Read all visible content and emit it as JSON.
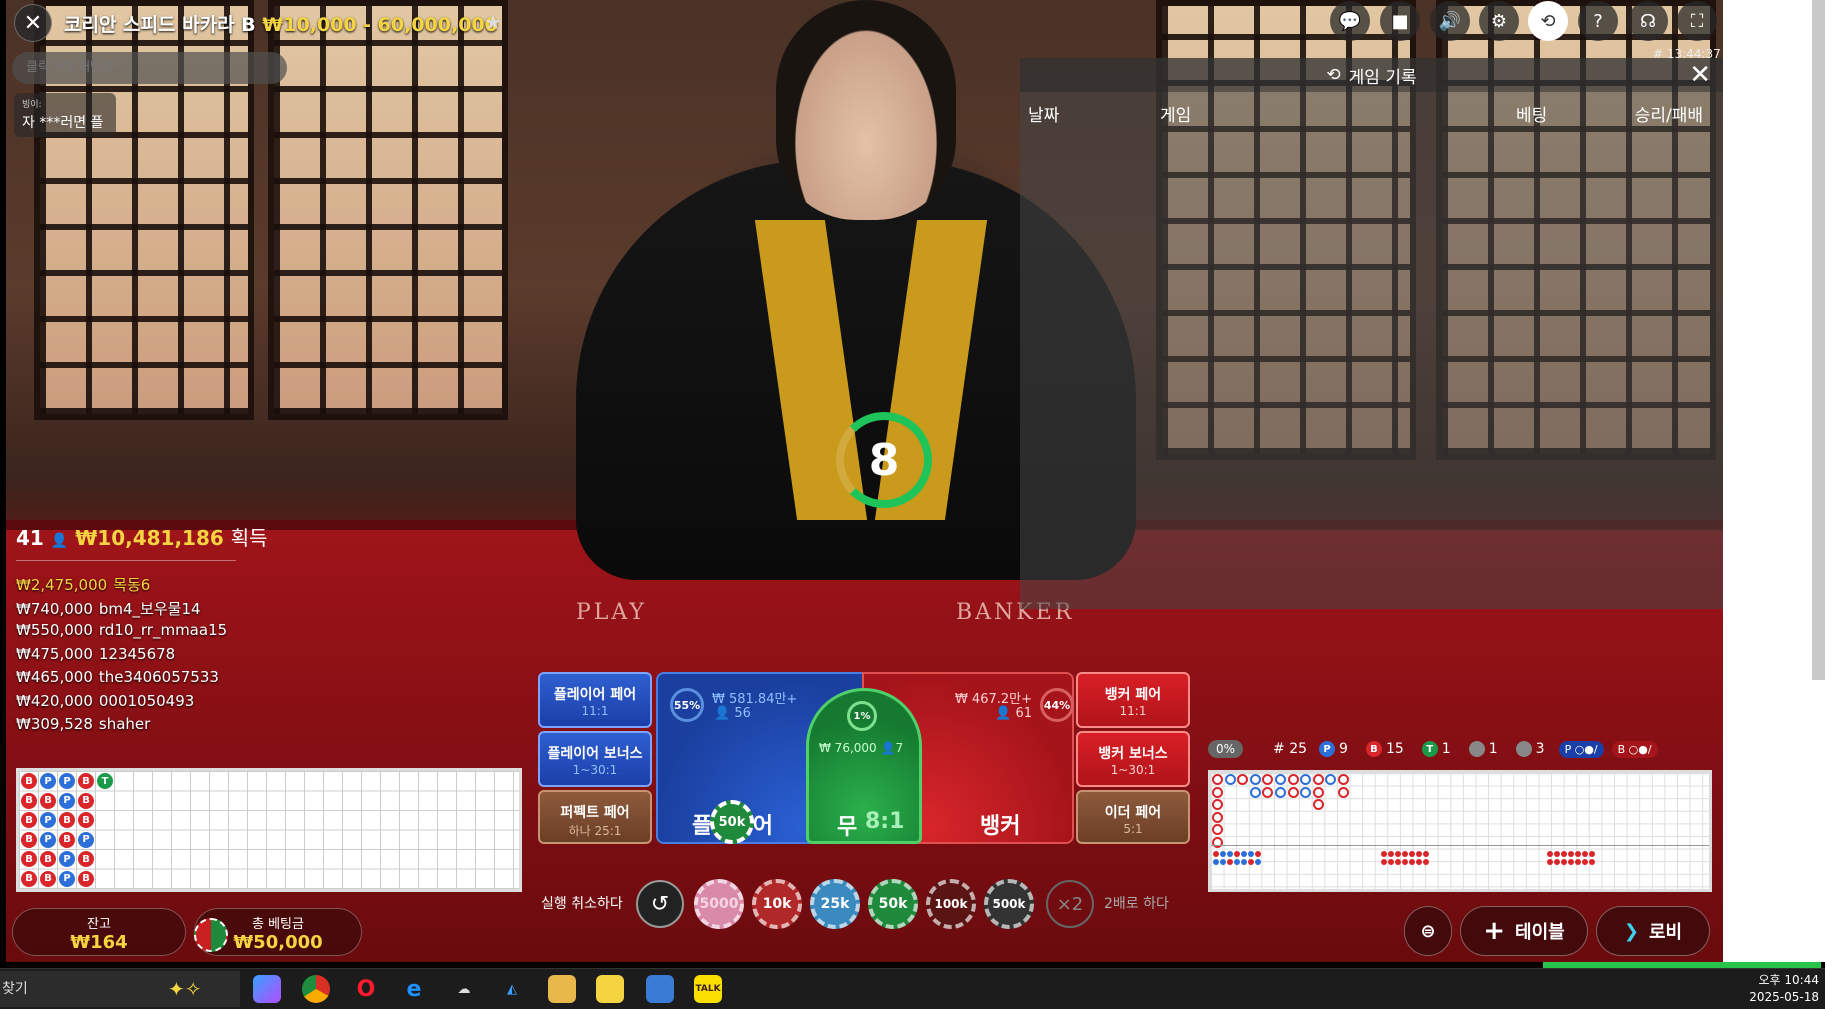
{
  "title": {
    "name": "코리안 스피드 바카라 B",
    "limits": "₩10,000 - 60,000,000"
  },
  "top_icons": [
    "chat-icon",
    "video-icon",
    "volume-icon",
    "gear-icon",
    "history-icon",
    "help-icon",
    "lobby-support-icon",
    "fullscreen-icon"
  ],
  "clock": "# 13:44:37",
  "chat": {
    "placeholder": "클릭하여 채팅하기",
    "sender": "빙이:",
    "message": "자 ***러면 플"
  },
  "history": {
    "title": "게임 기록",
    "columns": [
      "날짜",
      "게임",
      "베팅",
      "승리/패배"
    ]
  },
  "timer": "8",
  "winners": {
    "count": "41",
    "total": "₩10,481,186",
    "label": "획득",
    "list": [
      {
        "amount": "₩2,475,000",
        "name": "목동6"
      },
      {
        "amount": "₩740,000",
        "name": "bm4_보우물14"
      },
      {
        "amount": "₩550,000",
        "name": "rd10_rr_mmaa15"
      },
      {
        "amount": "₩475,000",
        "name": "12345678"
      },
      {
        "amount": "₩465,000",
        "name": "the3406057533"
      },
      {
        "amount": "₩420,000",
        "name": "0001050493"
      },
      {
        "amount": "₩309,528",
        "name": "shaher"
      }
    ]
  },
  "bead_road": [
    [
      "B",
      "B",
      "B",
      "B",
      "B",
      "B"
    ],
    [
      "P",
      "B",
      "P",
      "P",
      "B",
      "B"
    ],
    [
      "P",
      "P",
      "B",
      "B",
      "P",
      "P"
    ],
    [
      "B",
      "B",
      "B",
      "P",
      "B",
      "B"
    ],
    [
      "T"
    ]
  ],
  "bets": {
    "player_pair": {
      "label": "플레이어 페어",
      "odds": "11:1"
    },
    "player_bonus": {
      "label": "플레이어 보너스",
      "odds": "1~30:1"
    },
    "perfect_pair": {
      "label": "퍼펙트 페어",
      "odds": "하나 25:1"
    },
    "banker_pair": {
      "label": "뱅커 페어",
      "odds": "11:1"
    },
    "banker_bonus": {
      "label": "뱅커 보너스",
      "odds": "1~30:1"
    },
    "either_pair": {
      "label": "이더 페어",
      "odds": "5:1"
    },
    "player": {
      "label": "플레이어",
      "pct": "55%",
      "amount": "₩ 581.84만+",
      "players": "56"
    },
    "tie": {
      "label": "무",
      "odds": "8:1",
      "pct": "1%",
      "amount": "₩ 76,000",
      "players": "7"
    },
    "banker": {
      "label": "뱅커",
      "pct": "44%",
      "amount": "₩ 467.2만+",
      "players": "61"
    },
    "placed_chip": "50k"
  },
  "stats": {
    "pct": "0%",
    "round": "# 25",
    "player": "9",
    "banker": "15",
    "tie": "1",
    "player_pair": "1",
    "banker_pair": "3",
    "p_label": "P",
    "b_label": "B",
    "t_label": "T"
  },
  "controls": {
    "cancel": "실행 취소하다",
    "chips": [
      "5000",
      "10k",
      "25k",
      "50k",
      "100k",
      "500k"
    ],
    "double_icon": "×2",
    "double": "2배로 하다"
  },
  "balance": {
    "label": "잔고",
    "value": "₩164"
  },
  "total_bet": {
    "label": "총 베팅금",
    "value": "₩50,000"
  },
  "buttons": {
    "table": "테이블",
    "lobby": "로비"
  },
  "taskbar": {
    "search": "찾기",
    "time": "오후 10:44",
    "date": "2025-05-18",
    "apps": [
      "copilot",
      "chrome",
      "opera",
      "ie",
      "cloud",
      "app",
      "folder",
      "sticky",
      "notes",
      "kakaotalk"
    ],
    "kakao_label": "TALK"
  },
  "felt": {
    "player": "PLAY",
    "banker": "BANKER"
  },
  "colors": {
    "player": "#2d6fd8",
    "banker": "#d8262b",
    "tie": "#1a9b49",
    "gold": "#f5d442"
  }
}
